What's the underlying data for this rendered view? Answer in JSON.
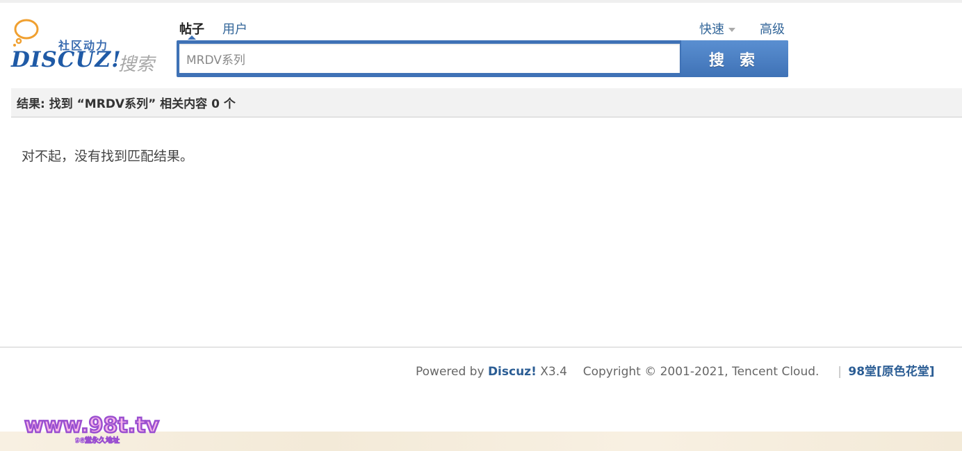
{
  "logo": {
    "tagline": "社区动力",
    "brand": "DISCUZ!",
    "search_word": "搜索"
  },
  "tabs": {
    "posts": "帖子",
    "users": "用户",
    "quick": "快速",
    "advanced": "高级"
  },
  "search": {
    "query": "MRDV系列",
    "button_label": "搜 索"
  },
  "result": {
    "summary": "结果: 找到 “MRDV系列” 相关内容 0 个",
    "empty_message": "对不起，没有找到匹配结果。"
  },
  "footer": {
    "powered_by": "Powered by",
    "brand": "Discuz!",
    "version": "X3.4",
    "copyright": "Copyright © 2001-2021, Tencent Cloud.",
    "separator": "|",
    "site_link": "98堂[原色花堂]"
  },
  "watermark": {
    "url": "www.98t.tv",
    "subtitle": "98堂永久地址"
  },
  "colors": {
    "accent": "#3f72b6",
    "link": "#336699"
  }
}
